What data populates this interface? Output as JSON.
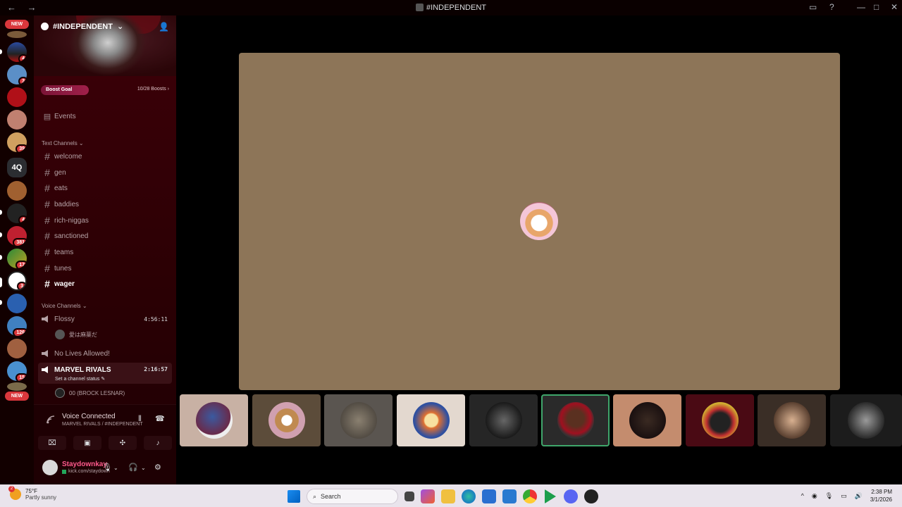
{
  "window": {
    "title": "#INDEPENDENT",
    "back": "←",
    "forward": "→"
  },
  "server_list": {
    "new_top": "NEW",
    "new_bottom": "NEW",
    "text_server": "4Q",
    "badges": [
      "4",
      "3",
      "39",
      "4",
      "381",
      "17",
      "3",
      "126",
      "15"
    ]
  },
  "server": {
    "name": "#INDEPENDENT",
    "boost_label": "Boost Goal",
    "boost_count": "10/28 Boosts",
    "events": "Events"
  },
  "text_channels": {
    "header": "Text Channels",
    "items": [
      "welcome",
      "gen",
      "eats",
      "baddies",
      "rich-niggas",
      "sanctioned",
      "teams",
      "tunes",
      "wager"
    ]
  },
  "voice_channels": {
    "header": "Voice Channels",
    "flossy": {
      "name": "Flossy",
      "time": "4:56:11",
      "member": "愛は麻薬だ"
    },
    "no_lives": {
      "name": "No Lives Allowed!"
    },
    "marvel": {
      "name": "MARVEL RIVALS",
      "time": "2:16:57",
      "status": "Set a channel status",
      "member": "00 (BROCK LESNAR)"
    }
  },
  "voice_connected": {
    "title": "Voice Connected",
    "subtitle": "MARVEL RIVALS / #INDEPENDENT"
  },
  "user_panel": {
    "name": "Staydownkay",
    "status": "kick.com/staydown"
  },
  "taskbar": {
    "weather_temp": "75°F",
    "weather_desc": "Partly sunny",
    "weather_badge": "2",
    "search_placeholder": "Search",
    "time": "2:38 PM",
    "date": "3/1/2026"
  },
  "colors": {
    "accent": "#3fa66b",
    "stage_tile": "#8d7558",
    "sidebar": "#2a0004",
    "username": "#ff5a8c"
  }
}
